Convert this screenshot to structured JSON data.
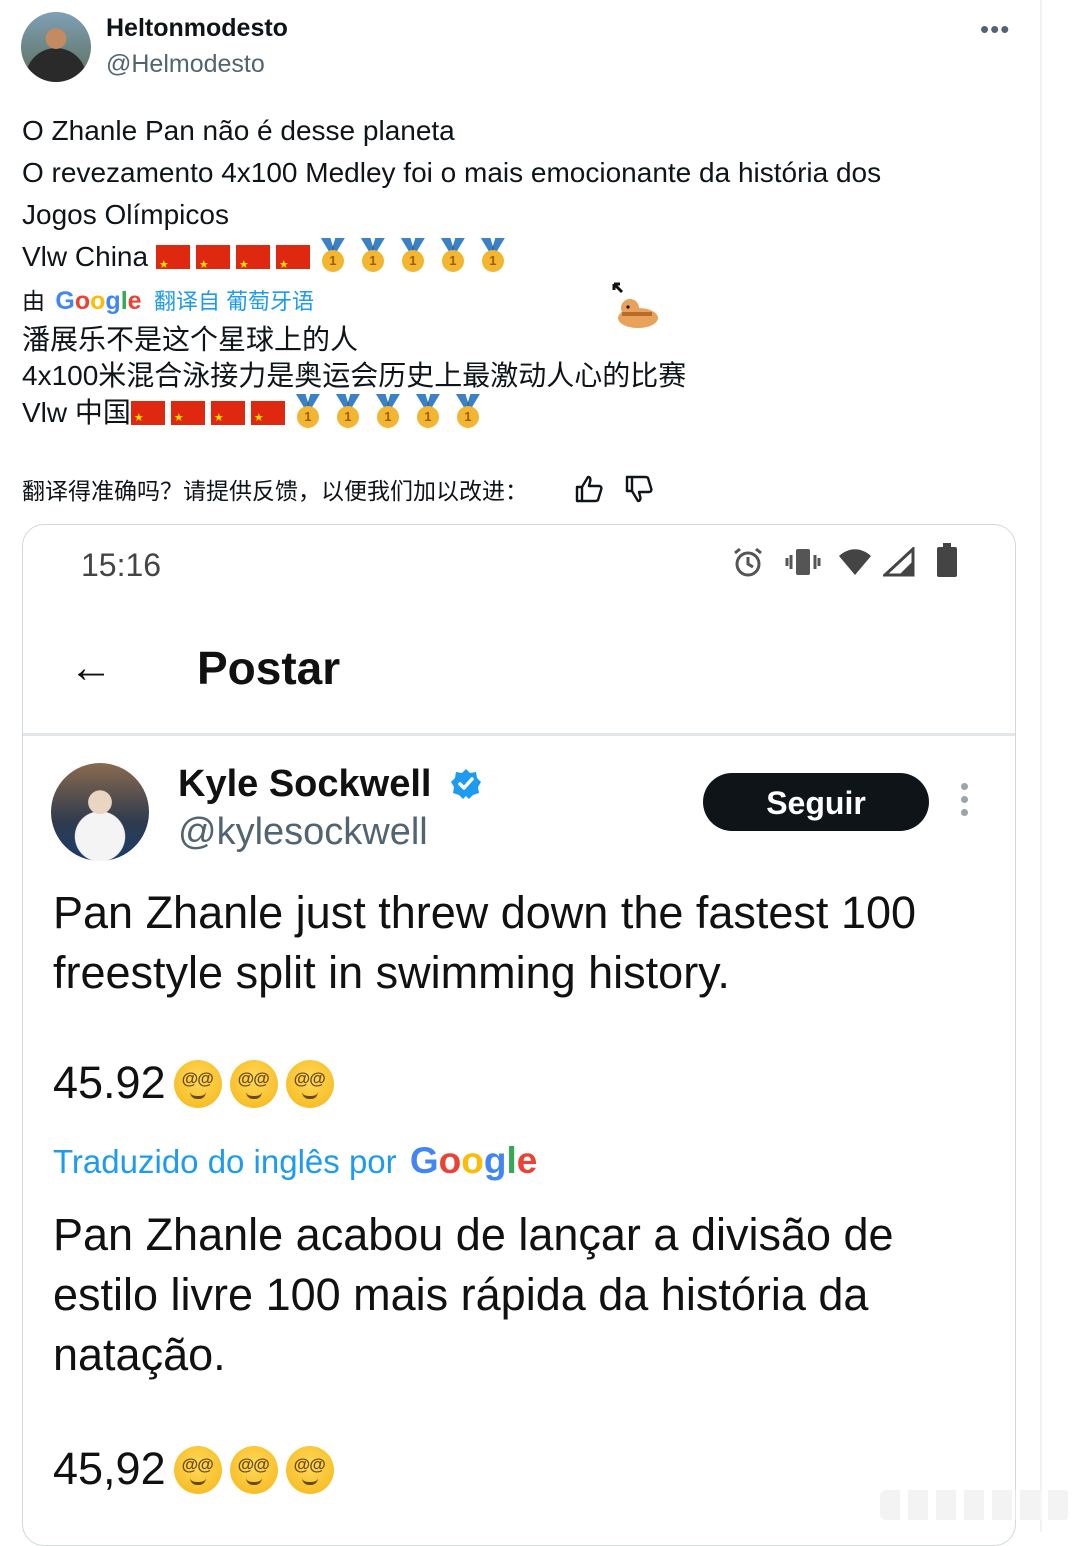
{
  "author": {
    "name": "Heltonmodesto",
    "handle": "@Helmodesto"
  },
  "more_label": "•••",
  "tweet": {
    "line1": "O Zhanle Pan não é desse planeta",
    "line2": "O revezamento 4x100 Medley foi o mais emocionante da história dos",
    "line3": "Jogos Olímpicos",
    "line4_text": "Vlw China"
  },
  "translation": {
    "prefix": "由",
    "google": [
      "G",
      "o",
      "o",
      "g",
      "l",
      "e"
    ],
    "link": "翻译自 葡萄牙语",
    "line1": "潘展乐不是这个星球上的人",
    "line2": "4x100米混合泳接力是奥运会历史上最激动人心的比赛",
    "line3_text": "Vlw 中国"
  },
  "feedback": {
    "prompt": "翻译得准确吗？请提供反馈，以便我们加以改进："
  },
  "screenshot": {
    "time": "15:16",
    "back_label": "←",
    "title": "Postar",
    "quoted": {
      "name": "Kyle Sockwell",
      "handle": "@kylesockwell",
      "follow_label": "Seguir",
      "text": "Pan Zhanle just threw down the fastest 100 freestyle split in swimming history.",
      "number": "45.92",
      "translate_label": "Traduzido do inglês por",
      "translated_text": "Pan Zhanle acabou de lançar a divisão de estilo livre 100 mais rápida da história da natação.",
      "translated_number": "45,92"
    }
  },
  "colors": {
    "link": "#1d9bf0",
    "flag": "#de2910",
    "button": "#0f1419"
  }
}
